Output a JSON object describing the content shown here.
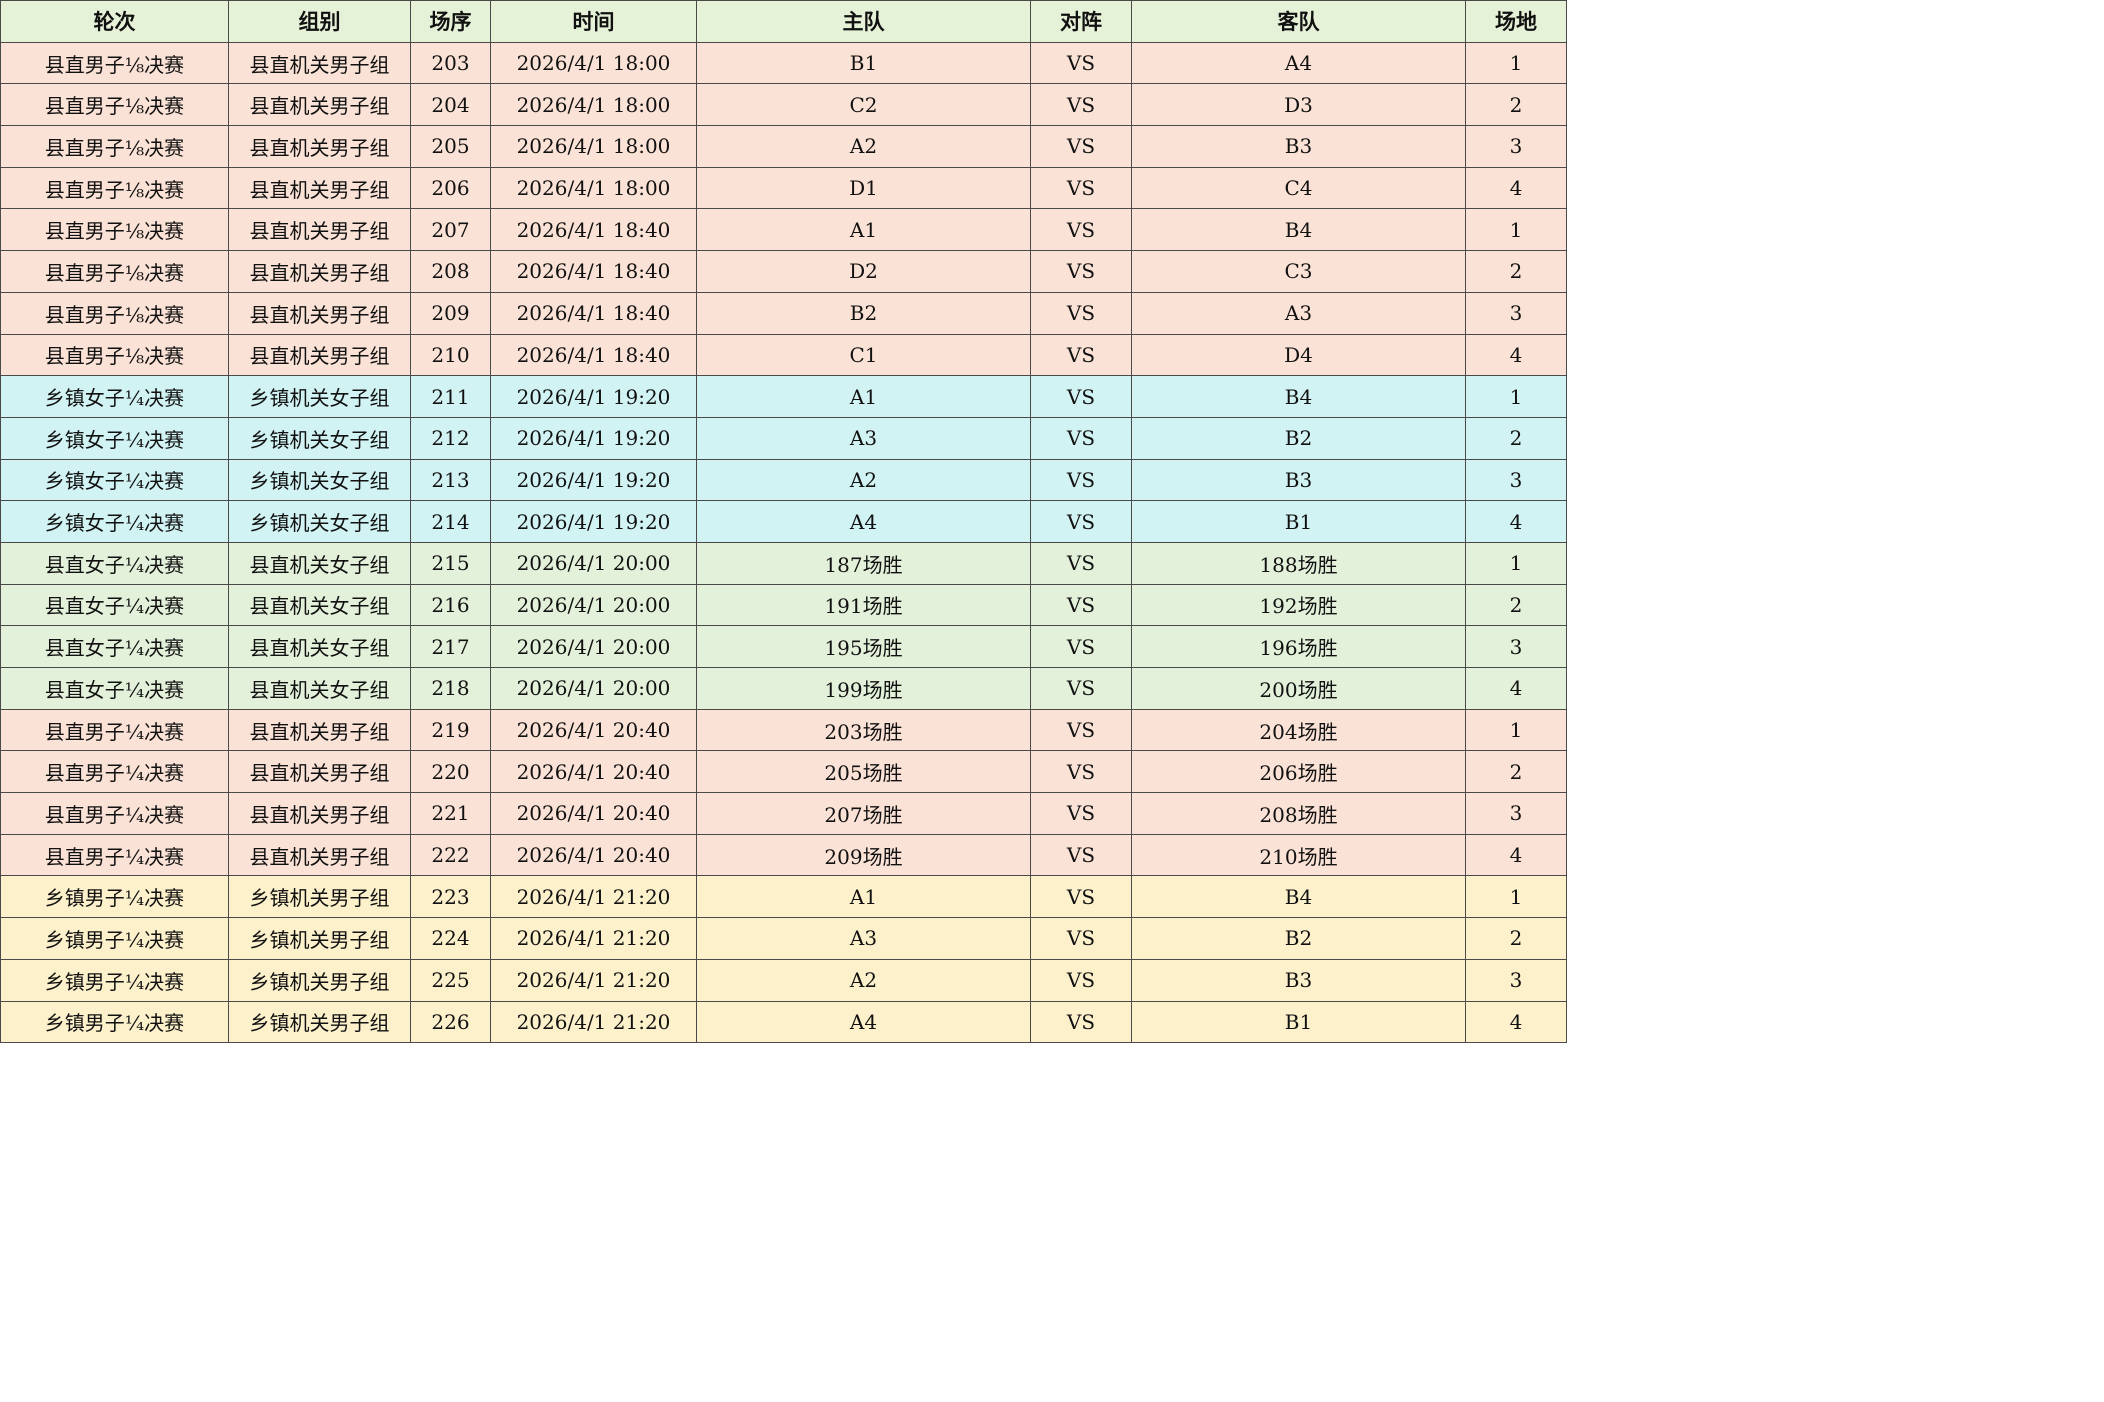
{
  "headers": [
    "轮次",
    "组别",
    "场序",
    "时间",
    "主队",
    "对阵",
    "客队",
    "场地"
  ],
  "rows": [
    {
      "group_type": "male-county",
      "cells": [
        "县直男子⅛决赛",
        "县直机关男子组",
        "203",
        "2026/4/1  18:00",
        "B1",
        "VS",
        "A4",
        "1"
      ]
    },
    {
      "group_type": "male-county",
      "cells": [
        "县直男子⅛决赛",
        "县直机关男子组",
        "204",
        "2026/4/1  18:00",
        "C2",
        "VS",
        "D3",
        "2"
      ]
    },
    {
      "group_type": "male-county",
      "cells": [
        "县直男子⅛决赛",
        "县直机关男子组",
        "205",
        "2026/4/1  18:00",
        "A2",
        "VS",
        "B3",
        "3"
      ]
    },
    {
      "group_type": "male-county",
      "cells": [
        "县直男子⅛决赛",
        "县直机关男子组",
        "206",
        "2026/4/1  18:00",
        "D1",
        "VS",
        "C4",
        "4"
      ]
    },
    {
      "group_type": "male-county",
      "cells": [
        "县直男子⅛决赛",
        "县直机关男子组",
        "207",
        "2026/4/1  18:40",
        "A1",
        "VS",
        "B4",
        "1"
      ]
    },
    {
      "group_type": "male-county",
      "cells": [
        "县直男子⅛决赛",
        "县直机关男子组",
        "208",
        "2026/4/1  18:40",
        "D2",
        "VS",
        "C3",
        "2"
      ]
    },
    {
      "group_type": "male-county",
      "cells": [
        "县直男子⅛决赛",
        "县直机关男子组",
        "209",
        "2026/4/1  18:40",
        "B2",
        "VS",
        "A3",
        "3"
      ]
    },
    {
      "group_type": "male-county",
      "cells": [
        "县直男子⅛决赛",
        "县直机关男子组",
        "210",
        "2026/4/1  18:40",
        "C1",
        "VS",
        "D4",
        "4"
      ]
    },
    {
      "group_type": "female-town",
      "cells": [
        "乡镇女子¼决赛",
        "乡镇机关女子组",
        "211",
        "2026/4/1  19:20",
        "A1",
        "VS",
        "B4",
        "1"
      ]
    },
    {
      "group_type": "female-town",
      "cells": [
        "乡镇女子¼决赛",
        "乡镇机关女子组",
        "212",
        "2026/4/1  19:20",
        "A3",
        "VS",
        "B2",
        "2"
      ]
    },
    {
      "group_type": "female-town",
      "cells": [
        "乡镇女子¼决赛",
        "乡镇机关女子组",
        "213",
        "2026/4/1  19:20",
        "A2",
        "VS",
        "B3",
        "3"
      ]
    },
    {
      "group_type": "female-town",
      "cells": [
        "乡镇女子¼决赛",
        "乡镇机关女子组",
        "214",
        "2026/4/1  19:20",
        "A4",
        "VS",
        "B1",
        "4"
      ]
    },
    {
      "group_type": "female-county",
      "cells": [
        "县直女子¼决赛",
        "县直机关女子组",
        "215",
        "2026/4/1  20:00",
        "187场胜",
        "VS",
        "188场胜",
        "1"
      ]
    },
    {
      "group_type": "female-county",
      "cells": [
        "县直女子¼决赛",
        "县直机关女子组",
        "216",
        "2026/4/1  20:00",
        "191场胜",
        "VS",
        "192场胜",
        "2"
      ]
    },
    {
      "group_type": "female-county",
      "cells": [
        "县直女子¼决赛",
        "县直机关女子组",
        "217",
        "2026/4/1  20:00",
        "195场胜",
        "VS",
        "196场胜",
        "3"
      ]
    },
    {
      "group_type": "female-county",
      "cells": [
        "县直女子¼决赛",
        "县直机关女子组",
        "218",
        "2026/4/1  20:00",
        "199场胜",
        "VS",
        "200场胜",
        "4"
      ]
    },
    {
      "group_type": "male-county",
      "cells": [
        "县直男子¼决赛",
        "县直机关男子组",
        "219",
        "2026/4/1  20:40",
        "203场胜",
        "VS",
        "204场胜",
        "1"
      ]
    },
    {
      "group_type": "male-county",
      "cells": [
        "县直男子¼决赛",
        "县直机关男子组",
        "220",
        "2026/4/1  20:40",
        "205场胜",
        "VS",
        "206场胜",
        "2"
      ]
    },
    {
      "group_type": "male-county",
      "cells": [
        "县直男子¼决赛",
        "县直机关男子组",
        "221",
        "2026/4/1  20:40",
        "207场胜",
        "VS",
        "208场胜",
        "3"
      ]
    },
    {
      "group_type": "male-county",
      "cells": [
        "县直男子¼决赛",
        "县直机关男子组",
        "222",
        "2026/4/1  20:40",
        "209场胜",
        "VS",
        "210场胜",
        "4"
      ]
    },
    {
      "group_type": "male-town",
      "cells": [
        "乡镇男子¼决赛",
        "乡镇机关男子组",
        "223",
        "2026/4/1  21:20",
        "A1",
        "VS",
        "B4",
        "1"
      ]
    },
    {
      "group_type": "male-town",
      "cells": [
        "乡镇男子¼决赛",
        "乡镇机关男子组",
        "224",
        "2026/4/1  21:20",
        "A3",
        "VS",
        "B2",
        "2"
      ]
    },
    {
      "group_type": "male-town",
      "cells": [
        "乡镇男子¼决赛",
        "乡镇机关男子组",
        "225",
        "2026/4/1  21:20",
        "A2",
        "VS",
        "B3",
        "3"
      ]
    },
    {
      "group_type": "male-town",
      "cells": [
        "乡镇男子¼决赛",
        "乡镇机关男子组",
        "226",
        "2026/4/1  21:20",
        "A4",
        "VS",
        "B1",
        "4"
      ]
    }
  ],
  "colors": {
    "header_bg": "#e6f2d8",
    "male-county": "#fbe2d6",
    "female-town": "#d2f3f4",
    "female-county": "#e4f1da",
    "male-town": "#fdf1cc",
    "border": "#4a4a4a"
  }
}
